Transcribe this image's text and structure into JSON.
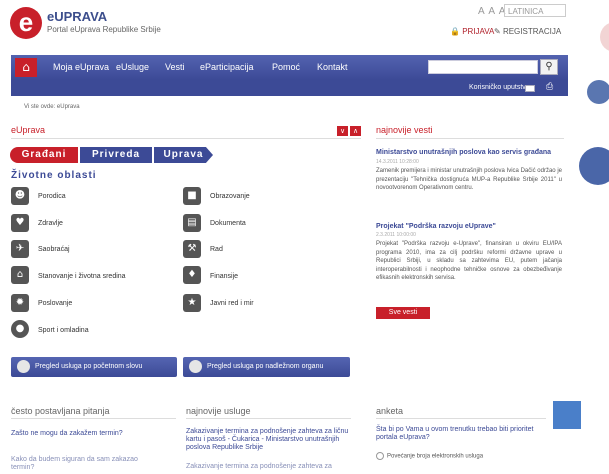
{
  "header": {
    "logo_letter": "e",
    "site_name": "eUPRAVA",
    "site_subtitle": "Portal eUprava Republike Srbije",
    "lang_icons": "A A A",
    "script_select": "LATINICA",
    "login": "PRIJAVA",
    "register": "REGISTRACIJA"
  },
  "nav": {
    "home_icon": "home-icon",
    "items": [
      "Moja eUprava",
      "eUsluge",
      "Vesti",
      "eParticipacija",
      "Pomoć",
      "Kontakt"
    ],
    "search_placeholder": "",
    "manual": "Korisničko uputstvo"
  },
  "breadcrumb": "Vi ste ovde: eUprava",
  "main": {
    "title": "eUprava",
    "tabs": [
      "Građani",
      "Privreda",
      "Uprava"
    ],
    "areas_title": "Životne oblasti",
    "categories_left": [
      "Porodica",
      "Zdravlje",
      "Saobraćaj",
      "Stanovanje i životna sredina",
      "Poslovanje",
      "Sport i omladina"
    ],
    "categories_right": [
      "Obrazovanje",
      "Dokumenta",
      "Rad",
      "Finansije",
      "Javni red i mir"
    ],
    "browse_alpha": "Pregled usluga po početnom slovu",
    "browse_org": "Pregled usluga po nadležnom organu"
  },
  "news": {
    "title": "najnovije vesti",
    "items": [
      {
        "headline": "Ministarstvo unutrašnjih poslova kao servis građana",
        "date": "14.3.2011 10:28:00",
        "text": "Zamenik premijera i ministar unutrašnjih poslova Ivica Dačić održao je prezentaciju \"Tehnička dostignuća MUP-a Republike Srbije 2011\" u novootvorenom Operativnom centru."
      },
      {
        "headline": "Projekat \"Podrška razvoju eUprave\"",
        "date": "2.3.2011 10:00:00",
        "text": "Projekat \"Podrška razvoju e-Uprave\", finansiran u okviru EU/IPA programa 2010, ima za cilj podršku reformi državne uprave u Republici Srbiji, u skladu sa zahtevima EU, putem jačanja interoperabilnosti i neophodne tehničke osnove za obezbeđivanje efikasnih elektronskih servisa."
      }
    ],
    "all_news": "Sve vesti"
  },
  "bottom": {
    "faq_title": "često postavljana pitanja",
    "faq_items": [
      "Zašto ne mogu da zakažem termin?",
      "Kako da budem siguran da sam zakazao termin?"
    ],
    "services_title": "najnovije usluge",
    "services_items": [
      "Zakazivanje termina za podnošenje zahteva za ličnu kartu i pasoš - Čukarica - Ministarstvo unutrašnjih poslova Republike Srbije",
      "Zakazivanje termina za podnošenje zahteva za"
    ],
    "poll_title": "anketa",
    "poll_question": "Šta bi po Vama u ovom trenutku trebao biti prioritet portala eUprava?",
    "poll_option": "Povećanje broja elektronskih usluga"
  },
  "colors": {
    "brand_red": "#c8202a",
    "brand_blue": "#3c4a96"
  }
}
